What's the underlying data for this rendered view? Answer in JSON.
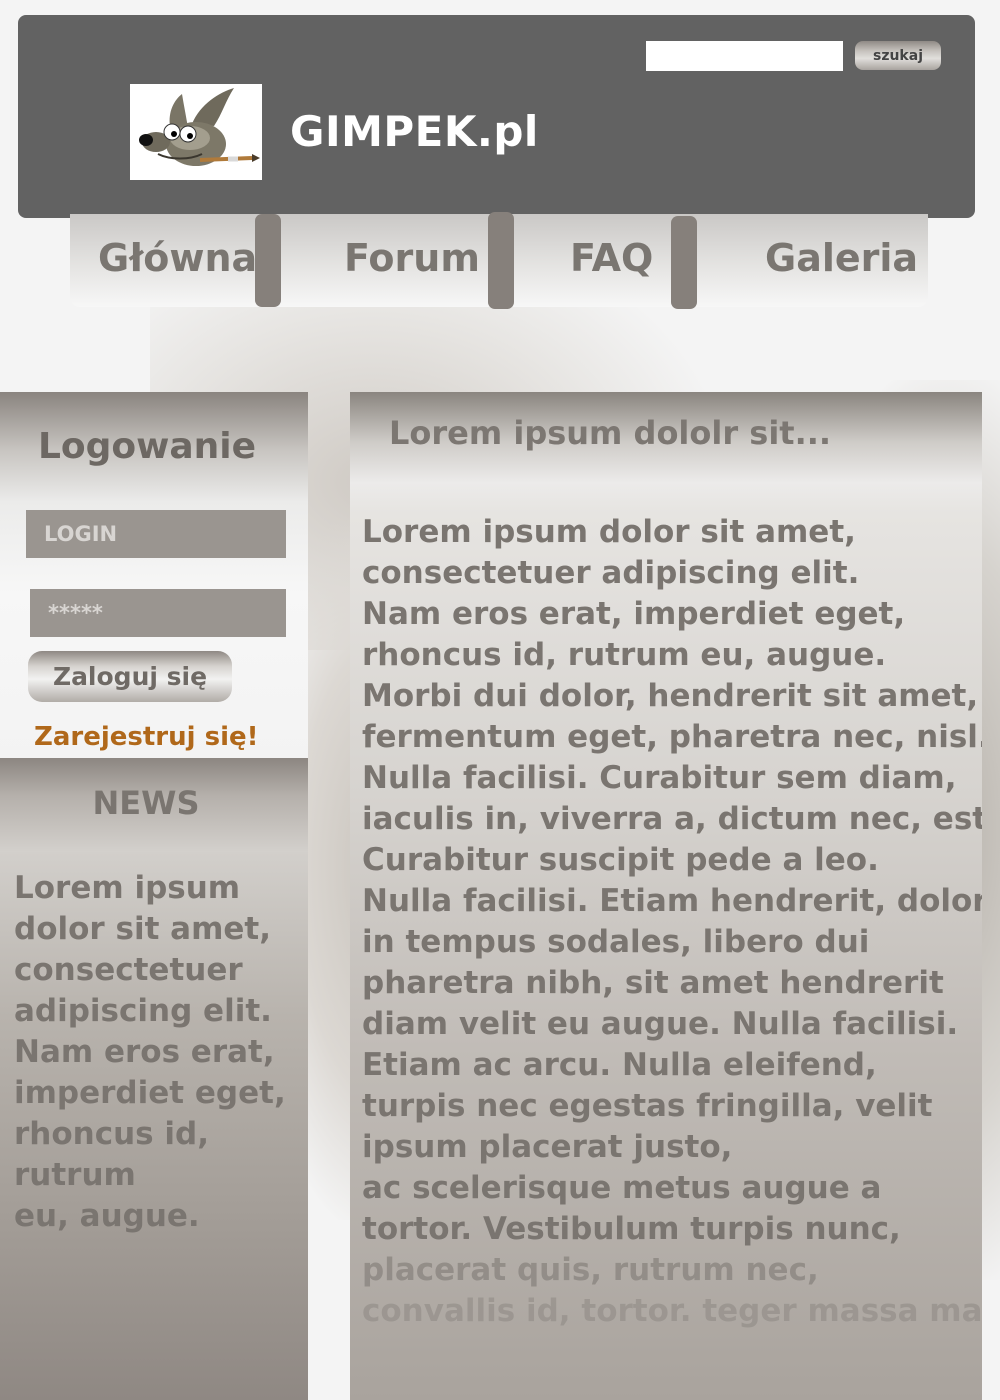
{
  "site": {
    "title": "GIMPEK.pl"
  },
  "search": {
    "button_label": "szukaj",
    "value": "",
    "placeholder": ""
  },
  "nav": {
    "items": [
      {
        "label": "Główna"
      },
      {
        "label": "Forum"
      },
      {
        "label": "FAQ"
      },
      {
        "label": "Galeria"
      }
    ]
  },
  "login": {
    "title": "Logowanie",
    "login_field": {
      "value": "LOGIN"
    },
    "password_field": {
      "value": "*****"
    },
    "button_label": "Zaloguj się",
    "register_label": "Zarejestruj się!"
  },
  "news": {
    "title": "NEWS",
    "lines": [
      "Lorem ipsum",
      "dolor sit amet,",
      "consectetuer",
      "adipiscing elit.",
      "Nam eros erat,",
      "imperdiet eget,",
      "rhoncus id,",
      "rutrum",
      "eu, augue."
    ]
  },
  "main": {
    "heading": "Lorem ipsum dololr sit...",
    "lines": [
      "Lorem ipsum dolor sit amet,",
      "consectetuer adipiscing elit.",
      "Nam eros erat, imperdiet eget,",
      "rhoncus id, rutrum eu, augue.",
      "Morbi dui dolor, hendrerit sit amet,",
      "fermentum eget, pharetra nec, nisl.",
      "Nulla facilisi. Curabitur sem diam,",
      "iaculis in, viverra a, dictum nec, est.",
      "Curabitur suscipit pede a leo.",
      "Nulla facilisi. Etiam hendrerit, dolor",
      "in tempus sodales, libero dui",
      "pharetra nibh, sit amet hendrerit",
      "diam velit eu augue. Nulla facilisi.",
      "Etiam ac arcu. Nulla eleifend,",
      "turpis nec egestas fringilla, velit",
      "ipsum placerat justo,",
      "ac scelerisque metus augue a",
      "tortor. Vestibulum turpis nunc,",
      "placerat quis, rutrum nec,",
      "convallis id, tortor. teger massa magna"
    ]
  },
  "colors": {
    "header_bg": "#626262",
    "register_link": "#b0681a",
    "text_muted": "#7a7570"
  },
  "icons": {
    "logo": "gimp-wilber-icon"
  }
}
